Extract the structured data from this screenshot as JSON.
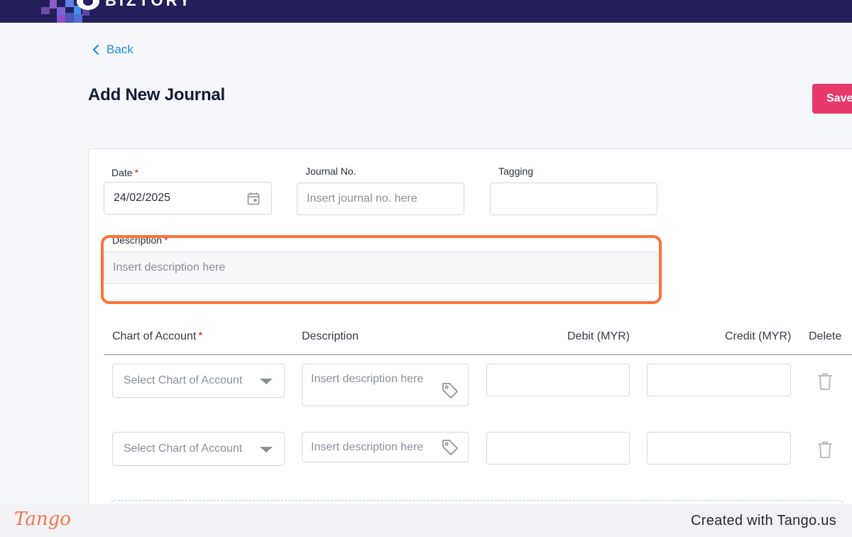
{
  "app": {
    "brand": "BIZTORY",
    "brand_colors": {
      "topbar": "#221f5a",
      "accent": "#1a8fd8",
      "primary_button": "#e8396b",
      "highlight": "#ff7139"
    }
  },
  "nav": {
    "back_label": "Back"
  },
  "page": {
    "title": "Add New Journal",
    "save_label": "Save"
  },
  "form": {
    "date": {
      "label": "Date",
      "required_mark": "*",
      "value": "24/02/2025"
    },
    "journal_no": {
      "label": "Journal No.",
      "placeholder": "Insert journal no. here"
    },
    "tagging": {
      "label": "Tagging",
      "value": ""
    },
    "description": {
      "label": "Description",
      "required_mark": "*",
      "placeholder": "Insert description here"
    }
  },
  "table": {
    "headers": {
      "chart_of_account": "Chart of Account",
      "required_mark": "*",
      "description": "Description",
      "debit": "Debit (MYR)",
      "credit": "Credit (MYR)",
      "delete": "Delete"
    },
    "rows": [
      {
        "account_placeholder": "Select Chart of Account",
        "description_placeholder": "Insert description here",
        "debit": "",
        "credit": ""
      },
      {
        "account_placeholder": "Select Chart of Account",
        "description_placeholder": "Insert description here",
        "debit": "",
        "credit": ""
      }
    ]
  },
  "footer": {
    "logo_text": "Tango",
    "credit_text": "Created with Tango.us"
  }
}
